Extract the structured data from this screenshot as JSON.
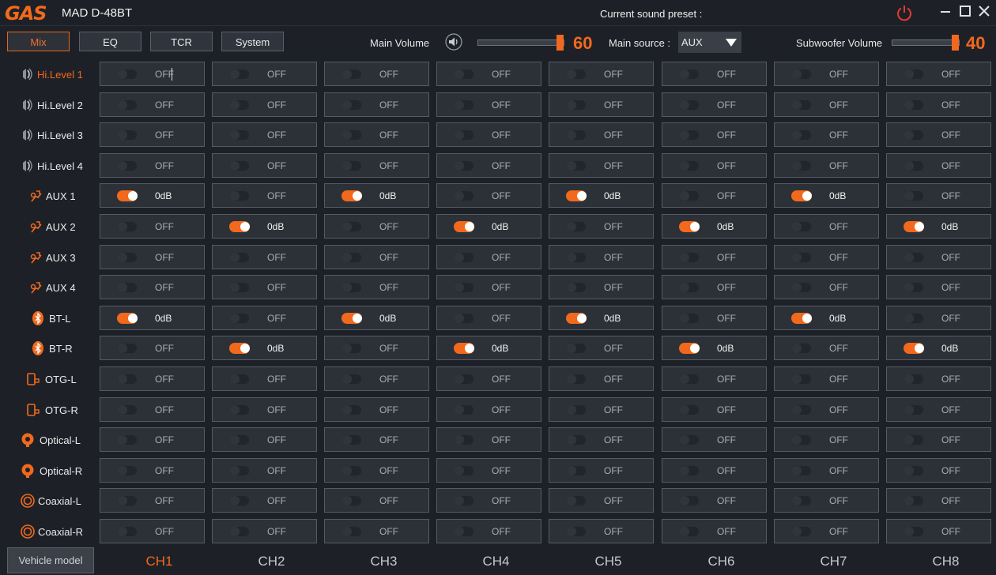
{
  "app": {
    "logo": "GAS",
    "model": "MAD D-48BT",
    "preset_label": "Current sound preset :"
  },
  "tabs": [
    {
      "label": "Mix",
      "active": true
    },
    {
      "label": "EQ",
      "active": false
    },
    {
      "label": "TCR",
      "active": false
    },
    {
      "label": "System",
      "active": false
    }
  ],
  "main_volume": {
    "label": "Main Volume",
    "value": "60",
    "level": 1.0
  },
  "main_source": {
    "label": "Main source :",
    "value": "AUX"
  },
  "subwoofer_volume": {
    "label": "Subwoofer Volume",
    "value": "40",
    "level": 1.0
  },
  "rows": [
    {
      "label": "Hi.Level 1",
      "icon": "speaker-icon",
      "selected": true,
      "on": []
    },
    {
      "label": "Hi.Level 2",
      "icon": "speaker-icon",
      "on": []
    },
    {
      "label": "Hi.Level 3",
      "icon": "speaker-icon",
      "on": []
    },
    {
      "label": "Hi.Level 4",
      "icon": "speaker-icon",
      "on": []
    },
    {
      "label": "AUX 1",
      "icon": "aux-cable-icon",
      "on": [
        1,
        3,
        5,
        7
      ]
    },
    {
      "label": "AUX 2",
      "icon": "aux-cable-icon",
      "on": [
        2,
        4,
        6,
        8
      ]
    },
    {
      "label": "AUX 3",
      "icon": "aux-cable-icon",
      "on": []
    },
    {
      "label": "AUX 4",
      "icon": "aux-cable-icon",
      "on": []
    },
    {
      "label": "BT-L",
      "icon": "bluetooth-icon",
      "on": [
        1,
        3,
        5,
        7
      ]
    },
    {
      "label": "BT-R",
      "icon": "bluetooth-icon",
      "on": [
        2,
        4,
        6,
        8
      ]
    },
    {
      "label": "OTG-L",
      "icon": "phone-usb-icon",
      "on": []
    },
    {
      "label": "OTG-R",
      "icon": "phone-usb-icon",
      "on": []
    },
    {
      "label": "Optical-L",
      "icon": "optical-icon",
      "on": []
    },
    {
      "label": "Optical-R",
      "icon": "optical-icon",
      "on": []
    },
    {
      "label": "Coaxial-L",
      "icon": "coaxial-icon",
      "on": []
    },
    {
      "label": "Coaxial-R",
      "icon": "coaxial-icon",
      "on": []
    }
  ],
  "values": {
    "on": "0dB",
    "off": "OFF"
  },
  "channels": [
    "CH1",
    "CH2",
    "CH3",
    "CH4",
    "CH5",
    "CH6",
    "CH7",
    "CH8"
  ],
  "selected_channel": 0,
  "vehicle_model": "Vehicle model",
  "colors": {
    "accent": "#f2691d",
    "background": "#1d2127",
    "cell": "#2c3138"
  }
}
